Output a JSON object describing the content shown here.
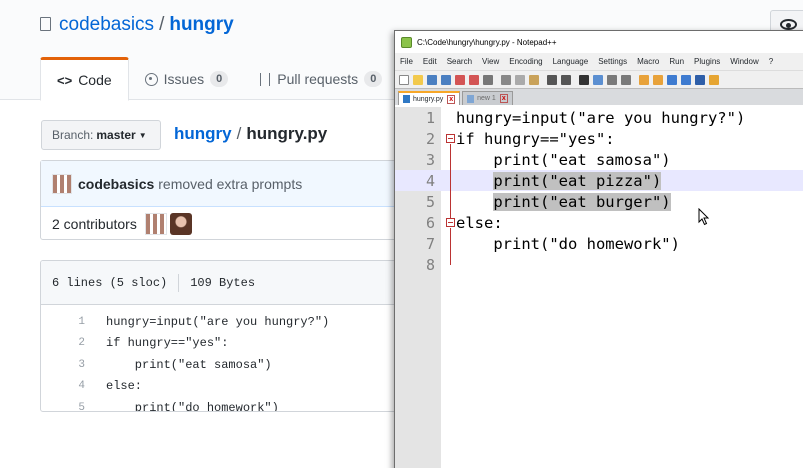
{
  "repo": {
    "owner": "codebasics",
    "separator": "/",
    "name": "hungry"
  },
  "tabs": [
    {
      "label": "Code",
      "icon": "code-icon",
      "active": true
    },
    {
      "label": "Issues",
      "count": "0",
      "icon": "issue-icon"
    },
    {
      "label": "Pull requests",
      "count": "0",
      "icon": "pull-request-icon"
    }
  ],
  "branch": {
    "label": "Branch:",
    "value": "master"
  },
  "breadcrumb": {
    "repo": "hungry",
    "separator": "/",
    "file": "hungry.py"
  },
  "commit": {
    "author": "codebasics",
    "message": "removed extra prompts"
  },
  "contributors": {
    "label": "2 contributors"
  },
  "file_info": {
    "lines": "6 lines (5 sloc)",
    "size": "109 Bytes"
  },
  "github_code": [
    {
      "num": "1",
      "text": "hungry=input(\"are you hungry?\")"
    },
    {
      "num": "2",
      "text": "if hungry==\"yes\":"
    },
    {
      "num": "3",
      "text": "    print(\"eat samosa\")"
    },
    {
      "num": "4",
      "text": "else:"
    },
    {
      "num": "5",
      "text": "    print(\"do homework\")"
    }
  ],
  "notepad": {
    "title": "C:\\Code\\hungry\\hungry.py - Notepad++",
    "menu": [
      "File",
      "Edit",
      "Search",
      "View",
      "Encoding",
      "Language",
      "Settings",
      "Macro",
      "Run",
      "Plugins",
      "Window",
      "?"
    ],
    "tabs": [
      {
        "label": "hungry.py",
        "active": true
      },
      {
        "label": "new 1",
        "active": false
      }
    ],
    "lines": [
      {
        "num": "1",
        "text": "hungry=input(\"are you hungry?\")"
      },
      {
        "num": "2",
        "text": "if hungry==\"yes\":"
      },
      {
        "num": "3",
        "text": "    print(\"eat samosa\")"
      },
      {
        "num": "4",
        "text": "    print(\"eat pizza\")"
      },
      {
        "num": "5",
        "text": "    print(\"eat burger\")"
      },
      {
        "num": "6",
        "text": "else:"
      },
      {
        "num": "7",
        "text": "    print(\"do homework\")"
      },
      {
        "num": "8",
        "text": ""
      }
    ]
  }
}
